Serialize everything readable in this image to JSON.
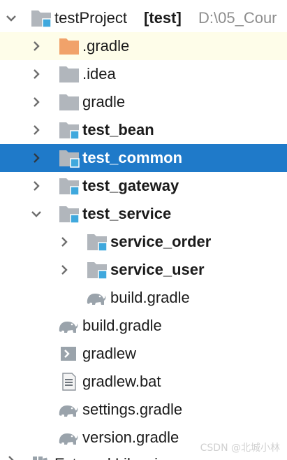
{
  "project": {
    "name": "testProject",
    "module_tag": "[test]",
    "path": "D:\\05_Cour"
  },
  "tree": [
    {
      "label": ".gradle",
      "icon": "folder-orange-icon"
    },
    {
      "label": ".idea",
      "icon": "folder-icon"
    },
    {
      "label": "gradle",
      "icon": "folder-icon"
    },
    {
      "label": "test_bean",
      "icon": "module-folder-icon"
    },
    {
      "label": "test_common",
      "icon": "module-folder-icon"
    },
    {
      "label": "test_gateway",
      "icon": "module-folder-icon"
    },
    {
      "label": "test_service",
      "icon": "module-folder-icon"
    },
    {
      "label": "service_order",
      "icon": "module-folder-icon"
    },
    {
      "label": "service_user",
      "icon": "module-folder-icon"
    },
    {
      "label": "build.gradle",
      "icon": "gradle-elephant-icon"
    },
    {
      "label": "build.gradle",
      "icon": "gradle-elephant-icon"
    },
    {
      "label": "gradlew",
      "icon": "shell-script-icon"
    },
    {
      "label": "gradlew.bat",
      "icon": "text-file-icon"
    },
    {
      "label": "settings.gradle",
      "icon": "gradle-elephant-icon"
    },
    {
      "label": "version.gradle",
      "icon": "gradle-elephant-icon"
    }
  ],
  "footer": {
    "external_libraries": "External Libraries",
    "watermark": "CSDN @北城小林"
  },
  "colors": {
    "selection": "#1f7ac9",
    "highlight_row": "#fefde9",
    "folder": "#b1b6bc",
    "folder_excluded": "#f1a26a",
    "module_badge": "#3fa8dd",
    "path_text": "#8d8d8d"
  }
}
